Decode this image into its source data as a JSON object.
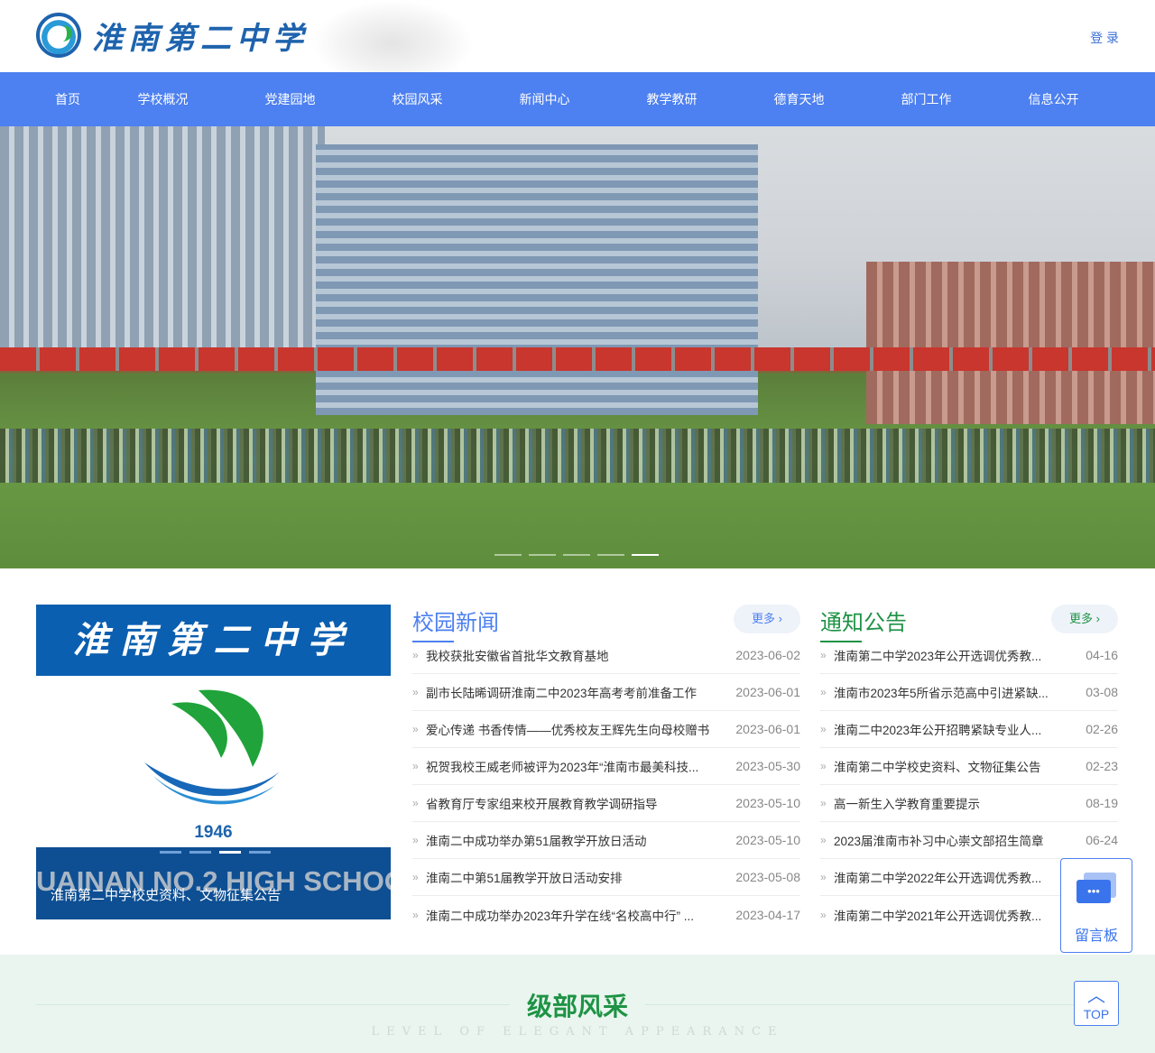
{
  "header": {
    "school_name": "淮南第二中学",
    "login": "登 录"
  },
  "nav": [
    "首页",
    "学校概况",
    "党建园地",
    "校园风采",
    "新闻中心",
    "教学教研",
    "德育天地",
    "部门工作",
    "信息公开"
  ],
  "hero": {
    "slides": 5,
    "active_slide": 5
  },
  "feature": {
    "banner": "淮南第二中学",
    "year": "1946",
    "english": "UAINAN NO.2 HIGH SCHOO",
    "caption": "淮南第二中学校史资料、文物征集公告",
    "slides": 4,
    "active_slide": 3
  },
  "news": {
    "title": "校园新闻",
    "more": "更多 ›",
    "items": [
      {
        "title": "我校获批安徽省首批华文教育基地",
        "date": "2023-06-02"
      },
      {
        "title": "副市长陆晞调研淮南二中2023年高考考前准备工作",
        "date": "2023-06-01"
      },
      {
        "title": "爱心传递 书香传情——优秀校友王辉先生向母校赠书",
        "date": "2023-06-01"
      },
      {
        "title": "祝贺我校王威老师被评为2023年“淮南市最美科技...",
        "date": "2023-05-30"
      },
      {
        "title": "省教育厅专家组来校开展教育教学调研指导",
        "date": "2023-05-10"
      },
      {
        "title": "淮南二中成功举办第51届教学开放日活动",
        "date": "2023-05-10"
      },
      {
        "title": "淮南二中第51届教学开放日活动安排",
        "date": "2023-05-08"
      },
      {
        "title": "淮南二中成功举办2023年升学在线“名校高中行” ...",
        "date": "2023-04-17"
      }
    ]
  },
  "notices": {
    "title": "通知公告",
    "more": "更多 ›",
    "items": [
      {
        "title": "淮南第二中学2023年公开选调优秀教...",
        "date": "04-16"
      },
      {
        "title": "淮南市2023年5所省示范高中引进紧缺...",
        "date": "03-08"
      },
      {
        "title": "淮南二中2023年公开招聘紧缺专业人...",
        "date": "02-26"
      },
      {
        "title": "淮南第二中学校史资料、文物征集公告",
        "date": "02-23"
      },
      {
        "title": "高一新生入学教育重要提示",
        "date": "08-19"
      },
      {
        "title": "2023届淮南市补习中心崇文部招生简章",
        "date": "06-24"
      },
      {
        "title": "淮南第二中学2022年公开选调优秀教...",
        "date": ""
      },
      {
        "title": "淮南第二中学2021年公开选调优秀教...",
        "date": ""
      }
    ]
  },
  "section": {
    "title": "级部风采",
    "subtitle": "LEVEL OF ELEGANT APPEARANCE"
  },
  "floating": {
    "message_board": "留言板",
    "top": "TOP"
  },
  "colors": {
    "nav": "#4d80f0",
    "news": "#4d80f0",
    "notices": "#1e9345"
  }
}
